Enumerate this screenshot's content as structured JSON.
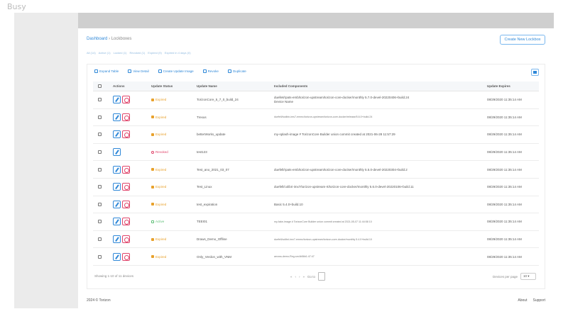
{
  "app": {
    "name": "Busy"
  },
  "breadcrumb": {
    "root": "Dashboard",
    "sep": "›",
    "current": "Lockboxes"
  },
  "header": {
    "create_button": "Create New Lockbox"
  },
  "filters": [
    "All (14)",
    "Active (1)",
    "Locked (1)",
    "Revoked (1)",
    "Expired (9)",
    "Expired in 4 days (0)"
  ],
  "toolbar": {
    "items": [
      "Expand Table",
      "View Detail",
      "Create Update Image",
      "Revoke",
      "Duplicate"
    ]
  },
  "table": {
    "columns": [
      "Actions",
      "Update Status",
      "Update Name",
      "Included Components",
      "Update Expires"
    ],
    "rows": [
      {
        "status": "Expired",
        "status_type": "expired",
        "name": "TorizonCore_5_7_0_build_24",
        "components": [
          "duellet/rpats-emb/torizon-upstream/torizon-core-docker/monthly 5.7.0-devel-20220406+build.24",
          "Device Name"
        ],
        "small": false,
        "expires": "08/29/2020 11:35:14 AM",
        "revoke": true
      },
      {
        "status": "Expired",
        "status_type": "expired",
        "name": "Trexus",
        "components": [
          "duefell/toolbin-ims7-emmc/torizon-upstream/torizon-core-docker/release/5.6.0+build.24"
        ],
        "small": true,
        "expires": "08/29/2020 11:35:14 AM",
        "revoke": true
      },
      {
        "status": "Expired",
        "status_type": "expired",
        "name": "betterWorks_update",
        "components": [
          "my-splash-image # TorizonCore Builder union commit created at 2021-06-28 11:57:29"
        ],
        "small": false,
        "expires": "08/29/2020 11:35:14 AM",
        "revoke": true
      },
      {
        "status": "Revoked",
        "status_type": "revoked",
        "name": "test123",
        "components": [
          ""
        ],
        "small": false,
        "expires": "08/29/2020 11:35:14 AM",
        "revoke": false
      },
      {
        "status": "Expired",
        "status_type": "expired",
        "name": "Test_ano_2021_03_07",
        "components": [
          "duefell/rpats-emb/torizon-upstream/torizon-core-docker/monthly 5.5.0-devel-20220304+build.2"
        ],
        "small": false,
        "expires": "08/29/2020 11:35:14 AM",
        "revoke": true
      },
      {
        "status": "Expired",
        "status_type": "expired",
        "name": "Test_Linux",
        "components": [
          "duefell/colibri-imx7/torizon-upstream-rt/torizon-core-docker/monthly 5.6.0-devel-20220106+build.11"
        ],
        "small": false,
        "expires": "08/29/2020 11:35:14 AM",
        "revoke": true
      },
      {
        "status": "Expired",
        "status_type": "expired",
        "name": "test_expiration",
        "components": [
          "Basic 5.4.0+build.10"
        ],
        "small": false,
        "expires": "08/29/2020 11:35:14 AM",
        "revoke": true
      },
      {
        "status": "Active",
        "status_type": "active",
        "name": "TEEI01",
        "components": [
          "my-fake-image # TorizonCore Builder union commit created at 2021-05-07 11:44:58 10"
        ],
        "small": true,
        "expires": "08/29/2020 11:35:14 AM",
        "revoke": true
      },
      {
        "status": "Expired",
        "status_type": "expired",
        "name": "Draws_Demo_Offline",
        "components": [
          "duefell/colibri-imx7-emmc/torizon-upstream/torizon-core-docker/monthly 5.4.0+build.10"
        ],
        "small": true,
        "expires": "08/29/2020 11:35:14 AM",
        "revoke": true
      },
      {
        "status": "Expired",
        "status_type": "expired",
        "name": "Only_Verdon_with_VNM",
        "components": [
          "arrows-demo-Reg-sm4b56b1:47:47"
        ],
        "small": true,
        "expires": "08/29/2020 11:35:14 AM",
        "revoke": true
      }
    ]
  },
  "pagination": {
    "showing": "Showing 1-10 of 11 devices",
    "first": "«",
    "prev": "‹",
    "next": "›",
    "last": "»",
    "goto_label": "Go to",
    "per_page_label": "Devices per page",
    "per_page_value": "10 ▾"
  },
  "footer": {
    "copyright": "2024 © Torizon",
    "links": [
      "About",
      "Support"
    ]
  },
  "colors": {
    "accent": "#2f88d8",
    "expired": "#e8a12b",
    "revoked": "#e0456b",
    "active": "#5fbf77"
  }
}
